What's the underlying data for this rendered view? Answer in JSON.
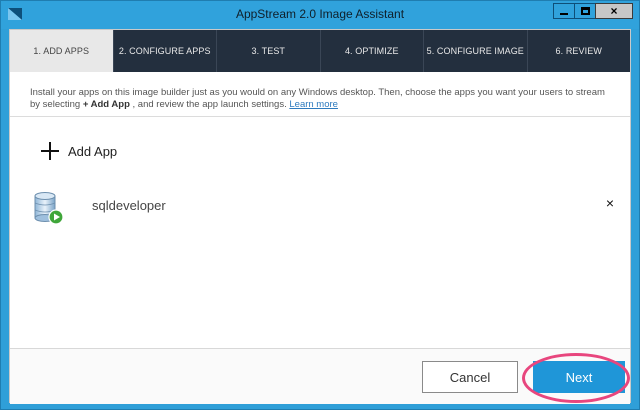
{
  "window": {
    "title": "AppStream 2.0 Image Assistant",
    "close_glyph": "×"
  },
  "tabs": [
    {
      "label": "1. ADD APPS",
      "active": true
    },
    {
      "label": "2. CONFIGURE APPS",
      "active": false
    },
    {
      "label": "3. TEST",
      "active": false
    },
    {
      "label": "4. OPTIMIZE",
      "active": false
    },
    {
      "label": "5. CONFIGURE IMAGE",
      "active": false
    },
    {
      "label": "6. REVIEW",
      "active": false
    }
  ],
  "intro": {
    "text_before": "Install your apps on this image builder just as you would on any Windows desktop. Then, choose the apps you want your users to stream by selecting ",
    "emphasis": "+ Add App",
    "text_after": " , and review the app launch settings. ",
    "link": "Learn more"
  },
  "add_app_label": "Add App",
  "apps": [
    {
      "name": "sqldeveloper",
      "remove_glyph": "×"
    }
  ],
  "footer": {
    "cancel_label": "Cancel",
    "next_label": "Next"
  },
  "colors": {
    "title_bar": "#30a2dc",
    "tab_bar": "#232f3e",
    "active_tab": "#e8e8e8",
    "primary_button": "#1f96d8",
    "annotation_ring": "#e8467e",
    "link": "#2e7bbf"
  },
  "icons": {
    "app_icon": "appstream-logo-icon",
    "db_icon": "database-play-icon",
    "plus_icon": "plus-icon",
    "remove_icon": "close-icon"
  }
}
